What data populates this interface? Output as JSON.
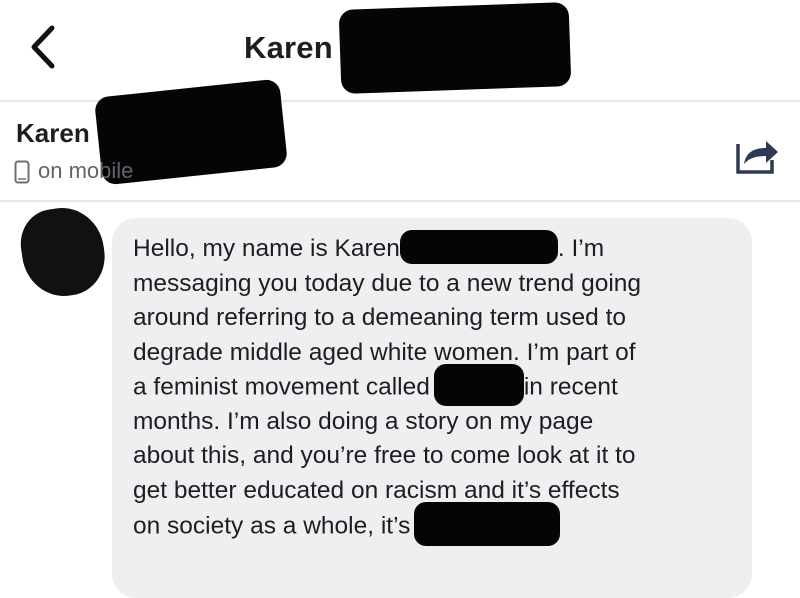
{
  "header": {
    "title": "Karen",
    "back_icon": "chevron-left-icon"
  },
  "conversation": {
    "sender_name": "Karen",
    "device_status": "on mobile",
    "device_icon": "mobile-phone-icon",
    "share_icon": "share-icon"
  },
  "message": {
    "lines": [
      {
        "before": "Hello, my name is Karen",
        "after": ". I’m"
      },
      {
        "text": "messaging you today due to a new trend going"
      },
      {
        "text": "around referring to a demeaning term used to"
      },
      {
        "text": "degrade middle aged white women. I’m part of"
      },
      {
        "before": "a feminist movement called",
        "after": "in recent"
      },
      {
        "text": "months. I’m also doing a story on my page"
      },
      {
        "text": "about this, and you’re free to come look at it to"
      },
      {
        "text": "get better educated on racism and it’s effects"
      },
      {
        "before": "on society as a whole, it’s",
        "after": ""
      }
    ]
  },
  "colors": {
    "bubble": "#efeff1",
    "redaction": "#050505",
    "divider": "#e6e6e8",
    "muted_text": "#60646b"
  }
}
